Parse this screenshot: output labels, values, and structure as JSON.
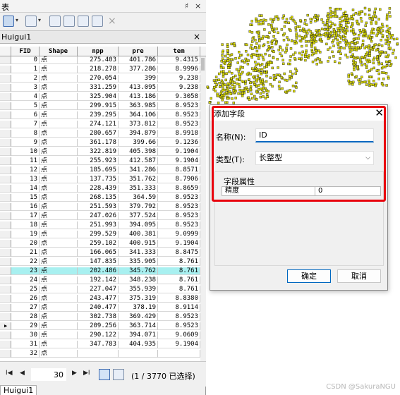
{
  "window": {
    "title": "表",
    "pin_glyph": "♯",
    "close_glyph": "×"
  },
  "toolbar": {
    "delete_glyph": "×"
  },
  "tab": {
    "label": "Huigui1",
    "close_glyph": "×"
  },
  "table": {
    "columns": [
      "FID",
      "Shape",
      "npp",
      "pre",
      "tem"
    ],
    "rows": [
      [
        "0",
        "点",
        "275.403",
        "401.786",
        "9.4315"
      ],
      [
        "1",
        "点",
        "218.278",
        "377.286",
        "8.9996"
      ],
      [
        "2",
        "点",
        "270.054",
        "399",
        "9.238"
      ],
      [
        "3",
        "点",
        "331.259",
        "413.095",
        "9.238"
      ],
      [
        "4",
        "点",
        "325.904",
        "413.186",
        "9.3058"
      ],
      [
        "5",
        "点",
        "299.915",
        "363.985",
        "8.9523"
      ],
      [
        "6",
        "点",
        "239.295",
        "364.106",
        "8.9523"
      ],
      [
        "7",
        "点",
        "274.121",
        "373.812",
        "8.9523"
      ],
      [
        "8",
        "点",
        "280.657",
        "394.879",
        "8.9918"
      ],
      [
        "9",
        "点",
        "361.178",
        "399.66",
        "9.1236"
      ],
      [
        "10",
        "点",
        "322.819",
        "405.398",
        "9.1904"
      ],
      [
        "11",
        "点",
        "255.923",
        "412.587",
        "9.1904"
      ],
      [
        "12",
        "点",
        "185.695",
        "341.286",
        "8.8571"
      ],
      [
        "13",
        "点",
        "137.735",
        "351.762",
        "8.7906"
      ],
      [
        "14",
        "点",
        "228.439",
        "351.333",
        "8.8659"
      ],
      [
        "15",
        "点",
        "268.135",
        "364.59",
        "8.9523"
      ],
      [
        "16",
        "点",
        "251.593",
        "379.792",
        "8.9523"
      ],
      [
        "17",
        "点",
        "247.026",
        "377.524",
        "8.9523"
      ],
      [
        "18",
        "点",
        "251.993",
        "394.095",
        "8.9523"
      ],
      [
        "19",
        "点",
        "299.529",
        "400.381",
        "9.0999"
      ],
      [
        "20",
        "点",
        "259.102",
        "400.915",
        "9.1904"
      ],
      [
        "21",
        "点",
        "166.065",
        "341.333",
        "8.8475"
      ],
      [
        "22",
        "点",
        "147.835",
        "335.905",
        "8.761"
      ],
      [
        "23",
        "点",
        "202.486",
        "345.762",
        "8.761"
      ],
      [
        "24",
        "点",
        "192.142",
        "348.238",
        "8.761"
      ],
      [
        "25",
        "点",
        "227.047",
        "355.939",
        "8.761"
      ],
      [
        "26",
        "点",
        "243.477",
        "375.319",
        "8.8380"
      ],
      [
        "27",
        "点",
        "240.477",
        "378.19",
        "8.9114"
      ],
      [
        "28",
        "点",
        "302.738",
        "369.429",
        "8.9523"
      ],
      [
        "29",
        "点",
        "209.256",
        "363.714",
        "8.9523"
      ],
      [
        "30",
        "点",
        "290.122",
        "394.071",
        "9.0609"
      ],
      [
        "31",
        "点",
        "347.783",
        "404.935",
        "9.1904"
      ],
      [
        "32",
        "点",
        "",
        "",
        ""
      ]
    ],
    "highlighted_row_fid": "23",
    "current_row_fid": "29"
  },
  "navigation": {
    "first_glyph": "I◀",
    "prev_glyph": "◀",
    "next_glyph": "▶",
    "last_glyph": "▶I",
    "current_record": "30",
    "status": "(1 / 3770 已选择)"
  },
  "bottom_tab": {
    "label": "Huigui1"
  },
  "dialog": {
    "title": "添加字段",
    "close_glyph": "✕",
    "name_label": "名称(N):",
    "name_value": "ID",
    "type_label": "类型(T):",
    "type_value": "长整型",
    "chevron_glyph": "⌵",
    "field_props_title": "字段属性",
    "prop_key": "精度",
    "prop_value": "0",
    "ok_label": "确定",
    "cancel_label": "取消"
  },
  "watermark": "CSDN @SakuraNGU",
  "colors": {
    "highlight_row": "#a8f0f0",
    "map_points": "#d8d800",
    "annotation_frame": "#e8000c",
    "accent": "#0067c0"
  }
}
